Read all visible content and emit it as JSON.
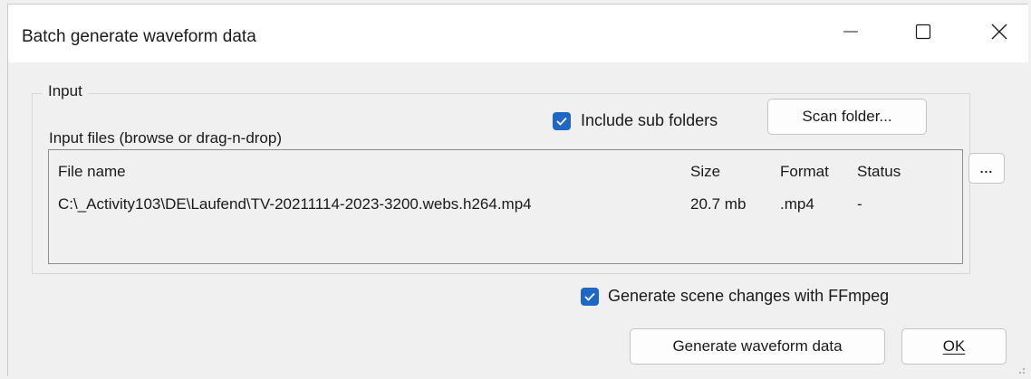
{
  "window": {
    "title": "Batch generate waveform data",
    "controls": [
      "minimize-icon",
      "maximize-icon",
      "close-icon"
    ]
  },
  "input_group": {
    "label": "Input",
    "files_label": "Input files (browse or drag-n-drop)",
    "include_sub_folders": {
      "label": "Include sub folders",
      "checked": true
    },
    "scan_folder_label": "Scan folder...",
    "browse_label": "...",
    "columns": [
      "File name",
      "Size",
      "Format",
      "Status"
    ],
    "rows": [
      {
        "file_name": "C:\\_Activity103\\DE\\Laufend\\TV-20211114-2023-3200.webs.h264.mp4",
        "size": "20.7 mb",
        "format": ".mp4",
        "status": "-"
      }
    ]
  },
  "options": {
    "generate_scene_changes": {
      "label": "Generate scene changes with FFmpeg",
      "checked": true
    }
  },
  "buttons": {
    "generate_label": "Generate waveform data",
    "ok_label": "OK"
  },
  "colors": {
    "accent": "#1f66c5",
    "window_bg": "#f0f0f0",
    "titlebar_bg": "#ffffff"
  }
}
